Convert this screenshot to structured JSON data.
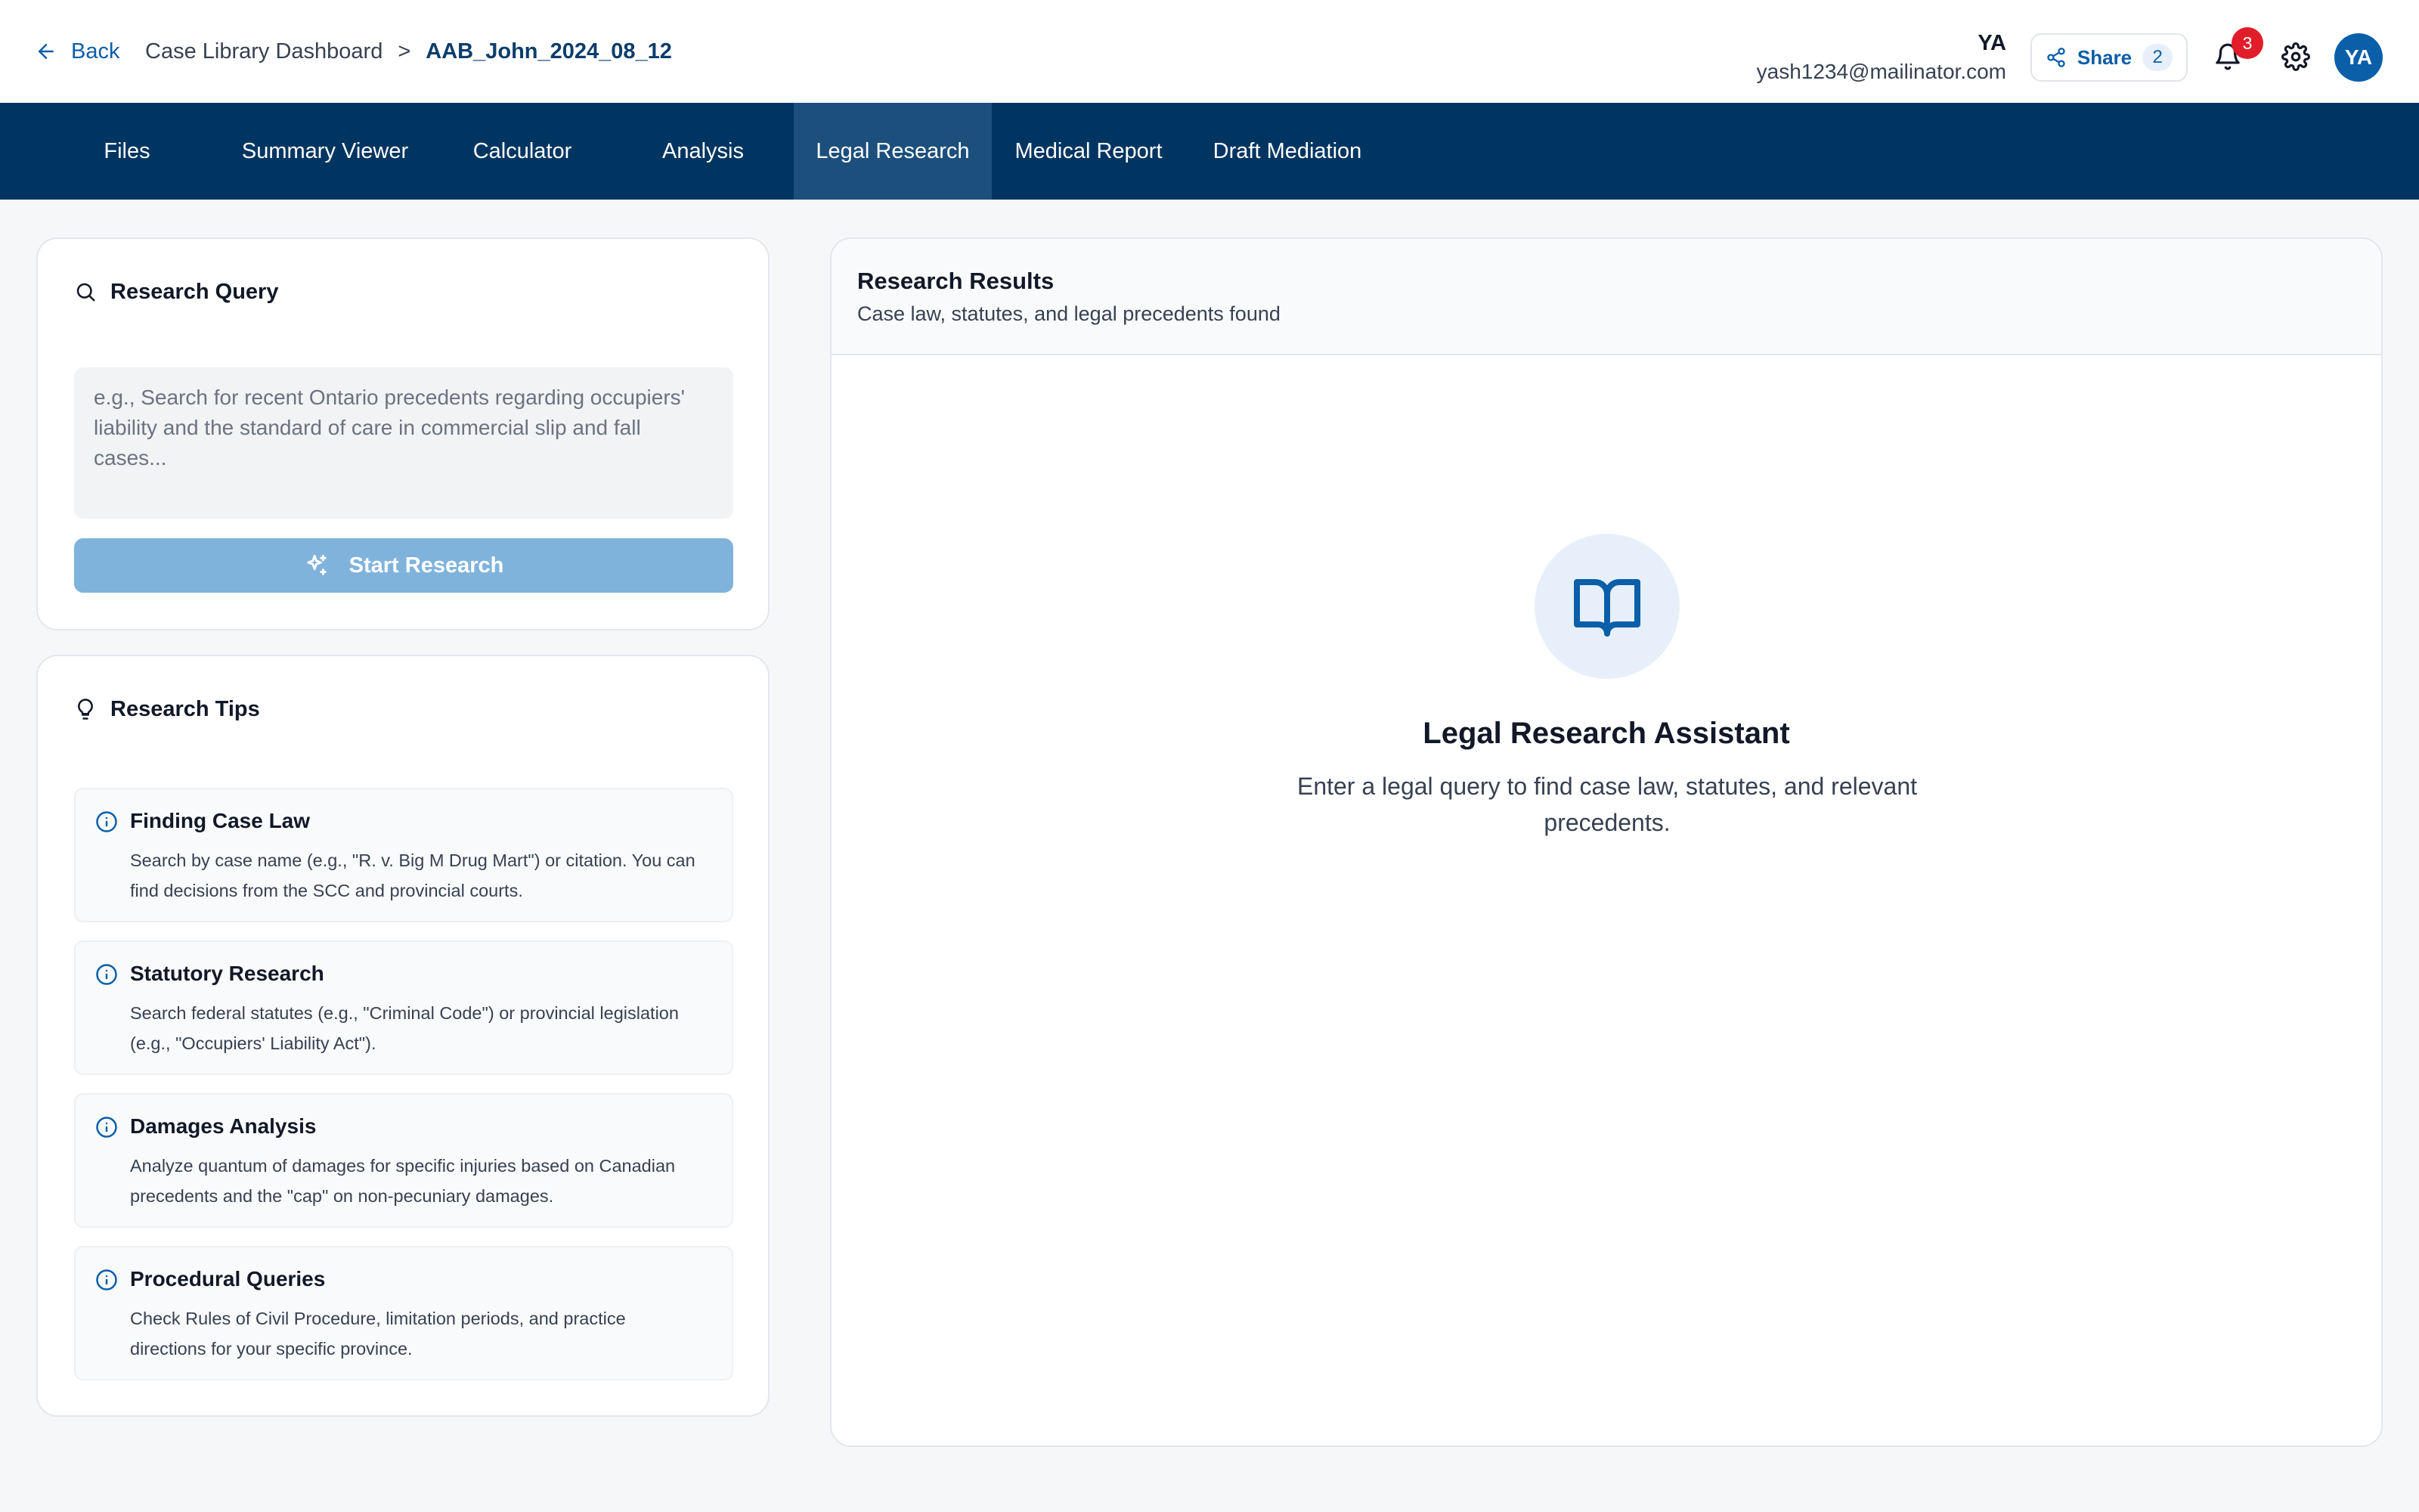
{
  "header": {
    "back_label": "Back",
    "breadcrumb": {
      "parent": "Case Library Dashboard",
      "separator": ">",
      "current": "AAB_John_2024_08_12"
    },
    "user": {
      "initials": "YA",
      "email": "yash1234@mailinator.com"
    },
    "share": {
      "label": "Share",
      "count": "2"
    },
    "notifications_count": "3",
    "avatar_initials": "YA"
  },
  "nav": {
    "tabs": [
      {
        "label": "Files"
      },
      {
        "label": "Summary Viewer"
      },
      {
        "label": "Calculator"
      },
      {
        "label": "Analysis"
      },
      {
        "label": "Legal Research",
        "active": true
      },
      {
        "label": "Medical Report"
      },
      {
        "label": "Draft Mediation"
      }
    ]
  },
  "query": {
    "title": "Research Query",
    "placeholder": "e.g., Search for recent Ontario precedents regarding occupiers' liability and the standard of care in commercial slip and fall cases...",
    "value": "",
    "button_label": "Start Research"
  },
  "tips": {
    "title": "Research Tips",
    "items": [
      {
        "title": "Finding Case Law",
        "body": "Search by case name (e.g., \"R. v. Big M Drug Mart\") or citation. You can find decisions from the SCC and provincial courts."
      },
      {
        "title": "Statutory Research",
        "body": "Search federal statutes (e.g., \"Criminal Code\") or provincial legislation (e.g., \"Occupiers' Liability Act\")."
      },
      {
        "title": "Damages Analysis",
        "body": "Analyze quantum of damages for specific injuries based on Canadian precedents and the \"cap\" on non-pecuniary damages."
      },
      {
        "title": "Procedural Queries",
        "body": "Check Rules of Civil Procedure, limitation periods, and practice directions for your specific province."
      }
    ]
  },
  "results": {
    "title": "Research Results",
    "subtitle": "Case law, statutes, and legal precedents found",
    "empty_title": "Legal Research Assistant",
    "empty_text": "Enter a legal query to find case law, statutes, and relevant precedents."
  },
  "colors": {
    "nav_bg": "#003562",
    "nav_active": "#1c4f7c",
    "accent": "#0b5ea8",
    "button_disabled": "#80b3dc",
    "badge": "#e11d2a"
  },
  "icons": {
    "back": "arrow-left-icon",
    "share": "share-icon",
    "notifications": "bell-icon",
    "settings": "gear-icon",
    "query": "search-icon",
    "start": "sparkles-icon",
    "tips": "lightbulb-icon",
    "tip_item": "info-icon",
    "empty_state": "book-open-icon"
  }
}
